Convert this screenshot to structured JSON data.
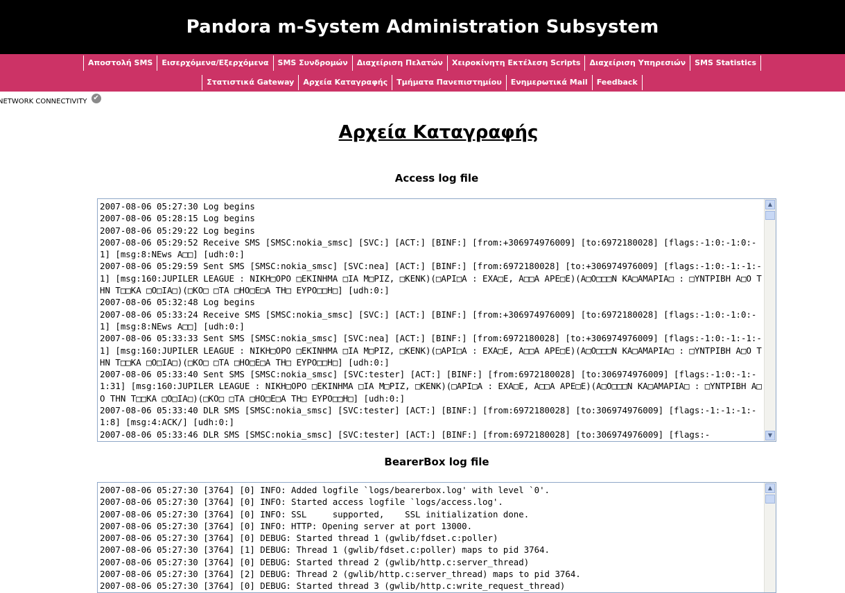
{
  "header": {
    "title": "Pandora m-System Administration Subsystem"
  },
  "nav": {
    "row1": [
      "Αποστολή SMS",
      "Εισερχόμενα/Εξερχόμενα",
      "SMS Συνδρομών",
      "Διαχείριση Πελατών",
      "Χειροκίνητη Εκτέλεση Scripts",
      "Διαχείριση Υπηρεσιών",
      "SMS Statistics"
    ],
    "row2": [
      "Στατιστικά Gateway",
      "Αρχεία Καταγραφής",
      "Τμήματα Πανεπιστημίου",
      "Ενημερωτικά Mail",
      "Feedback"
    ]
  },
  "status": {
    "network_label": "NETWORK CONNECTIVITY",
    "icon": "check-icon"
  },
  "page": {
    "title": "Αρχεία Καταγραφής"
  },
  "access_log": {
    "title": "Access log file",
    "lines": [
      "2007-08-06 05:27:30 Log begins",
      "2007-08-06 05:28:15 Log begins",
      "2007-08-06 05:29:22 Log begins",
      "2007-08-06 05:29:52 Receive SMS [SMSC:nokia_smsc] [SVC:] [ACT:] [BINF:] [from:+306974976009] [to:6972180028] [flags:-1:0:-1:0:-1] [msg:8:NEws A□□] [udh:0:]",
      "2007-08-06 05:29:59 Sent SMS [SMSC:nokia_smsc] [SVC:nea] [ACT:] [BINF:] [from:6972180028] [to:+306974976009] [flags:-1:0:-1:-1:-1] [msg:160:JUPILER LEAGUE : NIKH□OPO □EKINHMA □IA M□PIZ, □KENK)(□API□A : EXA□E, A□□A APE□E)(A□O□□□N KA□AMAPIA□ : □YNTPIBH A□O THN T□□KA □O□IA□)(□KO□ □TA □HO□E□A TH□ EYPO□□H□] [udh:0:]",
      "2007-08-06 05:32:48 Log begins",
      "2007-08-06 05:33:24 Receive SMS [SMSC:nokia_smsc] [SVC:] [ACT:] [BINF:] [from:+306974976009] [to:6972180028] [flags:-1:0:-1:0:-1] [msg:8:NEws A□□] [udh:0:]",
      "2007-08-06 05:33:33 Sent SMS [SMSC:nokia_smsc] [SVC:nea] [ACT:] [BINF:] [from:6972180028] [to:+306974976009] [flags:-1:0:-1:-1:-1] [msg:160:JUPILER LEAGUE : NIKH□OPO □EKINHMA □IA M□PIZ, □KENK)(□API□A : EXA□E, A□□A APE□E)(A□O□□□N KA□AMAPIA□ : □YNTPIBH A□O THN T□□KA □O□IA□)(□KO□ □TA □HO□E□A TH□ EYPO□□H□] [udh:0:]",
      "2007-08-06 05:33:40 Sent SMS [SMSC:nokia_smsc] [SVC:tester] [ACT:] [BINF:] [from:6972180028] [to:306974976009] [flags:-1:0:-1:-1:31] [msg:160:JUPILER LEAGUE : NIKH□OPO □EKINHMA □IA M□PIZ, □KENK)(□API□A : EXA□E, A□□A APE□E)(A□O□□□N KA□AMAPIA□ : □YNTPIBH A□O THN T□□KA □O□IA□)(□KO□ □TA □HO□E□A TH□ EYPO□□H□] [udh:0:]",
      "2007-08-06 05:33:40 DLR SMS [SMSC:nokia_smsc] [SVC:tester] [ACT:] [BINF:] [from:6972180028] [to:306974976009] [flags:-1:-1:-1:-1:8] [msg:4:ACK/] [udh:0:]",
      "2007-08-06 05:33:46 DLR SMS [SMSC:nokia_smsc] [SVC:tester] [ACT:] [BINF:] [from:6972180028] [to:306974976009] [flags:-"
    ]
  },
  "bearerbox_log": {
    "title": "BearerBox log file",
    "lines": [
      "2007-08-06 05:27:30 [3764] [0] INFO: Added logfile `logs/bearerbox.log' with level `0'.",
      "2007-08-06 05:27:30 [3764] [0] INFO: Started access logfile `logs/access.log'.",
      "2007-08-06 05:27:30 [3764] [0] INFO: SSL     supported,    SSL initialization done.",
      "2007-08-06 05:27:30 [3764] [0] INFO: HTTP: Opening server at port 13000.",
      "2007-08-06 05:27:30 [3764] [0] DEBUG: Started thread 1 (gwlib/fdset.c:poller)",
      "2007-08-06 05:27:30 [3764] [1] DEBUG: Thread 1 (gwlib/fdset.c:poller) maps to pid 3764.",
      "2007-08-06 05:27:30 [3764] [0] DEBUG: Started thread 2 (gwlib/http.c:server_thread)",
      "2007-08-06 05:27:30 [3764] [2] DEBUG: Thread 2 (gwlib/http.c:server_thread) maps to pid 3764.",
      "2007-08-06 05:27:30 [3764] [0] DEBUG: Started thread 3 (gwlib/http.c:write_request_thread)"
    ]
  }
}
